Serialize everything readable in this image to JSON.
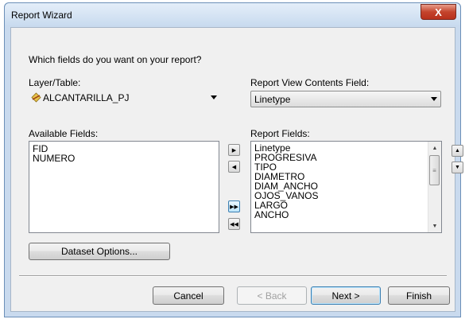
{
  "window": {
    "title": "Report Wizard",
    "close_glyph": "X"
  },
  "prompt": "Which fields do you want on your report?",
  "layer": {
    "label": "Layer/Table:",
    "value": "ALCANTARILLA_PJ",
    "icon": "line-layer-icon"
  },
  "report_view": {
    "label": "Report View Contents Field:",
    "value": "Linetype"
  },
  "available_fields": {
    "label": "Available Fields:",
    "items": [
      "FID",
      "NUMERO"
    ]
  },
  "report_fields": {
    "label": "Report Fields:",
    "items": [
      "Linetype",
      "PROGRESIVA",
      "TIPO",
      "DIAMETRO",
      "DIAM_ANCHO",
      "OJOS_VANOS",
      "LARGO",
      "ANCHO"
    ]
  },
  "move_buttons": {
    "add_one": "▶",
    "remove_one": "◀",
    "add_all": "▶▶",
    "remove_all": "◀◀"
  },
  "order_buttons": {
    "up": "▲",
    "down": "▼"
  },
  "dataset_options_label": "Dataset Options...",
  "footer": {
    "cancel": "Cancel",
    "back": "< Back",
    "next": "Next >",
    "finish": "Finish"
  },
  "colors": {
    "title_bar": "#c9daee",
    "close_button": "#c4442c",
    "dialog_bg": "#f0f0f0"
  }
}
